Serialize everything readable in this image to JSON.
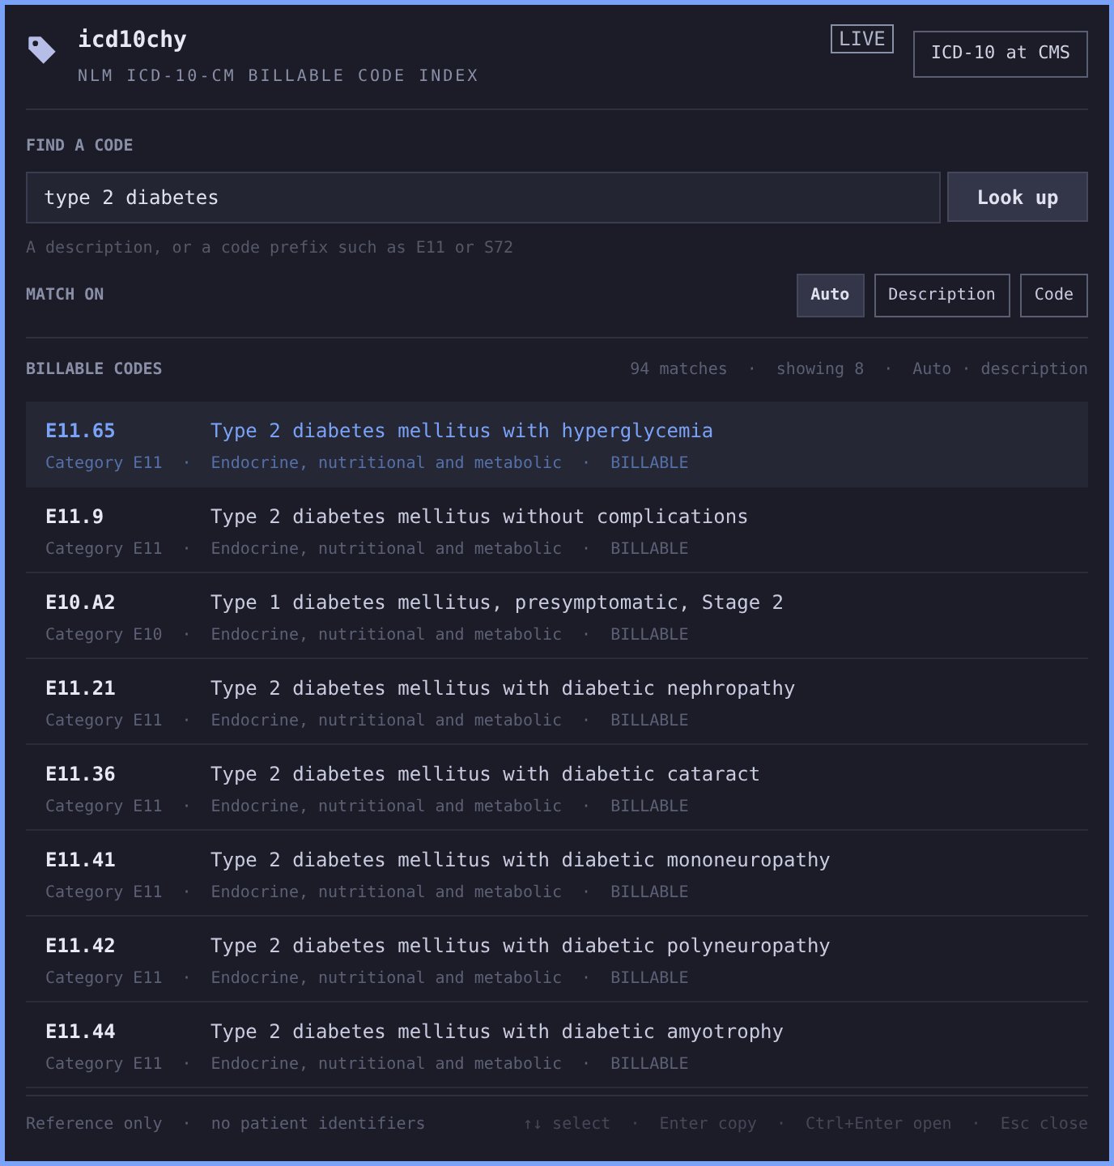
{
  "header": {
    "title": "icd10chy",
    "subtitle": "NLM ICD-10-CM BILLABLE CODE INDEX",
    "badge": "LIVE",
    "link": "ICD-10 at CMS"
  },
  "search": {
    "label": "FIND A CODE",
    "value": "type 2 diabetes",
    "button": "Look up",
    "hint": "A description, or a code prefix such as E11 or S72"
  },
  "match": {
    "label": "MATCH ON",
    "options": [
      {
        "label": "Auto",
        "selected": true
      },
      {
        "label": "Description",
        "selected": false
      },
      {
        "label": "Code",
        "selected": false
      }
    ]
  },
  "separator": "·",
  "results": {
    "heading": "BILLABLE CODES",
    "stats": [
      "94 matches",
      "showing 8",
      "Auto · description"
    ],
    "rows": [
      {
        "code": "E11.65",
        "title": "Type 2 diabetes mellitus with hyperglycemia",
        "category": "Category E11",
        "chapter": "Endocrine, nutritional and metabolic",
        "status": "BILLABLE",
        "selected": true
      },
      {
        "code": "E11.9",
        "title": "Type 2 diabetes mellitus without complications",
        "category": "Category E11",
        "chapter": "Endocrine, nutritional and metabolic",
        "status": "BILLABLE",
        "selected": false
      },
      {
        "code": "E10.A2",
        "title": "Type 1 diabetes mellitus, presymptomatic, Stage 2",
        "category": "Category E10",
        "chapter": "Endocrine, nutritional and metabolic",
        "status": "BILLABLE",
        "selected": false
      },
      {
        "code": "E11.21",
        "title": "Type 2 diabetes mellitus with diabetic nephropathy",
        "category": "Category E11",
        "chapter": "Endocrine, nutritional and metabolic",
        "status": "BILLABLE",
        "selected": false
      },
      {
        "code": "E11.36",
        "title": "Type 2 diabetes mellitus with diabetic cataract",
        "category": "Category E11",
        "chapter": "Endocrine, nutritional and metabolic",
        "status": "BILLABLE",
        "selected": false
      },
      {
        "code": "E11.41",
        "title": "Type 2 diabetes mellitus with diabetic mononeuropathy",
        "category": "Category E11",
        "chapter": "Endocrine, nutritional and metabolic",
        "status": "BILLABLE",
        "selected": false
      },
      {
        "code": "E11.42",
        "title": "Type 2 diabetes mellitus with diabetic polyneuropathy",
        "category": "Category E11",
        "chapter": "Endocrine, nutritional and metabolic",
        "status": "BILLABLE",
        "selected": false
      },
      {
        "code": "E11.44",
        "title": "Type 2 diabetes mellitus with diabetic amyotrophy",
        "category": "Category E11",
        "chapter": "Endocrine, nutritional and metabolic",
        "status": "BILLABLE",
        "selected": false
      }
    ]
  },
  "footer": {
    "notes": [
      "Reference only",
      "no patient identifiers"
    ],
    "shortcuts": [
      "↑↓ select",
      "Enter copy",
      "Ctrl+Enter open",
      "Esc close"
    ]
  }
}
